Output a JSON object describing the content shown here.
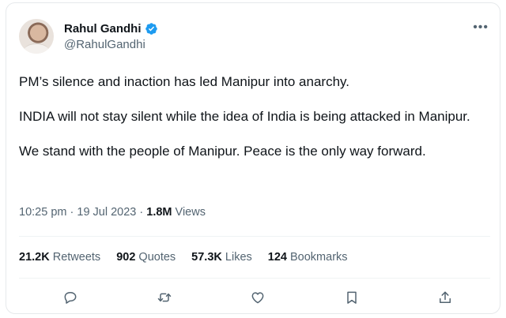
{
  "author": {
    "display_name": "Rahul Gandhi",
    "handle": "@RahulGandhi",
    "verified": true
  },
  "tweet": {
    "paragraphs": [
      "PM’s silence and inaction has led Manipur into anarchy.",
      "INDIA will not stay silent while the idea of India is being attacked in Manipur.",
      "We stand with the people of Manipur. Peace is the only way forward."
    ],
    "time": "10:25 pm",
    "separator": "·",
    "date": "19 Jul 2023",
    "views_count": "1.8M",
    "views_label": "Views"
  },
  "stats": {
    "retweets_count": "21.2K",
    "retweets_label": "Retweets",
    "quotes_count": "902",
    "quotes_label": "Quotes",
    "likes_count": "57.3K",
    "likes_label": "Likes",
    "bookmarks_count": "124",
    "bookmarks_label": "Bookmarks"
  },
  "icons": {
    "more": "more-icon",
    "verified": "verified-badge-icon",
    "reply": "reply-icon",
    "retweet": "retweet-icon",
    "like": "heart-icon",
    "bookmark": "bookmark-icon",
    "share": "share-icon"
  },
  "colors": {
    "verified_blue": "#1d9bf0",
    "text_primary": "#0f1419",
    "text_secondary": "#536471",
    "border": "#e6e9eb"
  }
}
